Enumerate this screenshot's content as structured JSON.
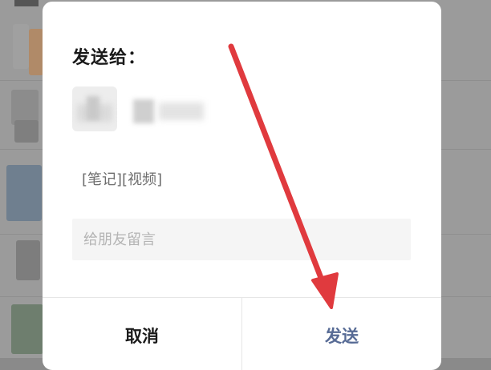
{
  "dialog": {
    "title": "发送给：",
    "recipient": {
      "avatar": "blurred-avatar",
      "name_hidden": true
    },
    "content_preview": "[笔记][视频]",
    "message": {
      "placeholder": "给朋友留言",
      "value": ""
    },
    "buttons": {
      "cancel_label": "取消",
      "send_label": "发送"
    }
  },
  "annotation": {
    "arrow_color": "#e03a3e",
    "points_to": "send-button"
  },
  "colors": {
    "send_accent": "#576b95",
    "overlay": "#9b9b9b",
    "dialog_bg": "#ffffff"
  }
}
